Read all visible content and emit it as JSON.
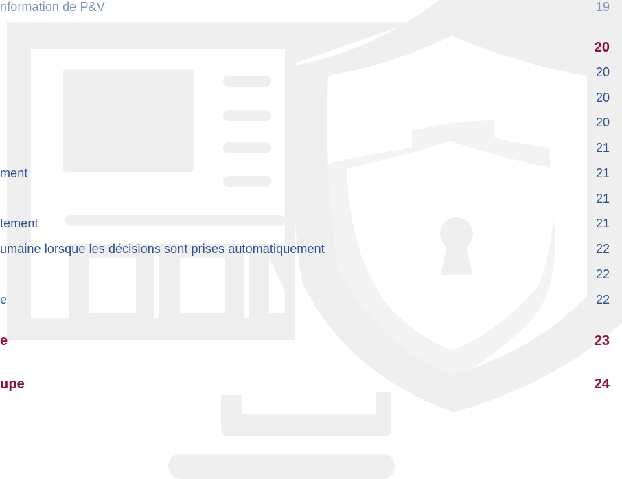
{
  "colors": {
    "section_text": "#2d4f8f",
    "chapter_text": "#8a1538",
    "watermark": "#efefef"
  },
  "watermark_icons": [
    "computer-monitor-icon",
    "shield-icon",
    "lock-icon",
    "keyhole-icon"
  ],
  "toc": [
    {
      "text": "nformation de P&V",
      "page": "19",
      "level": "section",
      "faded": true
    },
    {
      "text": "",
      "page": "20",
      "level": "chapter"
    },
    {
      "text": "",
      "page": "20",
      "level": "section"
    },
    {
      "text": "",
      "page": "20",
      "level": "section"
    },
    {
      "text": "",
      "page": "20",
      "level": "section"
    },
    {
      "text": "",
      "page": "21",
      "level": "section"
    },
    {
      "text": "ment",
      "page": "21",
      "level": "section"
    },
    {
      "text": "",
      "page": "21",
      "level": "section"
    },
    {
      "text": "tement",
      "page": "21",
      "level": "section"
    },
    {
      "text": "umaine lorsque les décisions sont prises automatiquement",
      "page": "22",
      "level": "section"
    },
    {
      "text": "",
      "page": "22",
      "level": "section"
    },
    {
      "text": "e",
      "page": "22",
      "level": "section"
    },
    {
      "text": "e",
      "page": "23",
      "level": "chapter"
    },
    {
      "text": "upe",
      "page": "24",
      "level": "chapter"
    }
  ]
}
